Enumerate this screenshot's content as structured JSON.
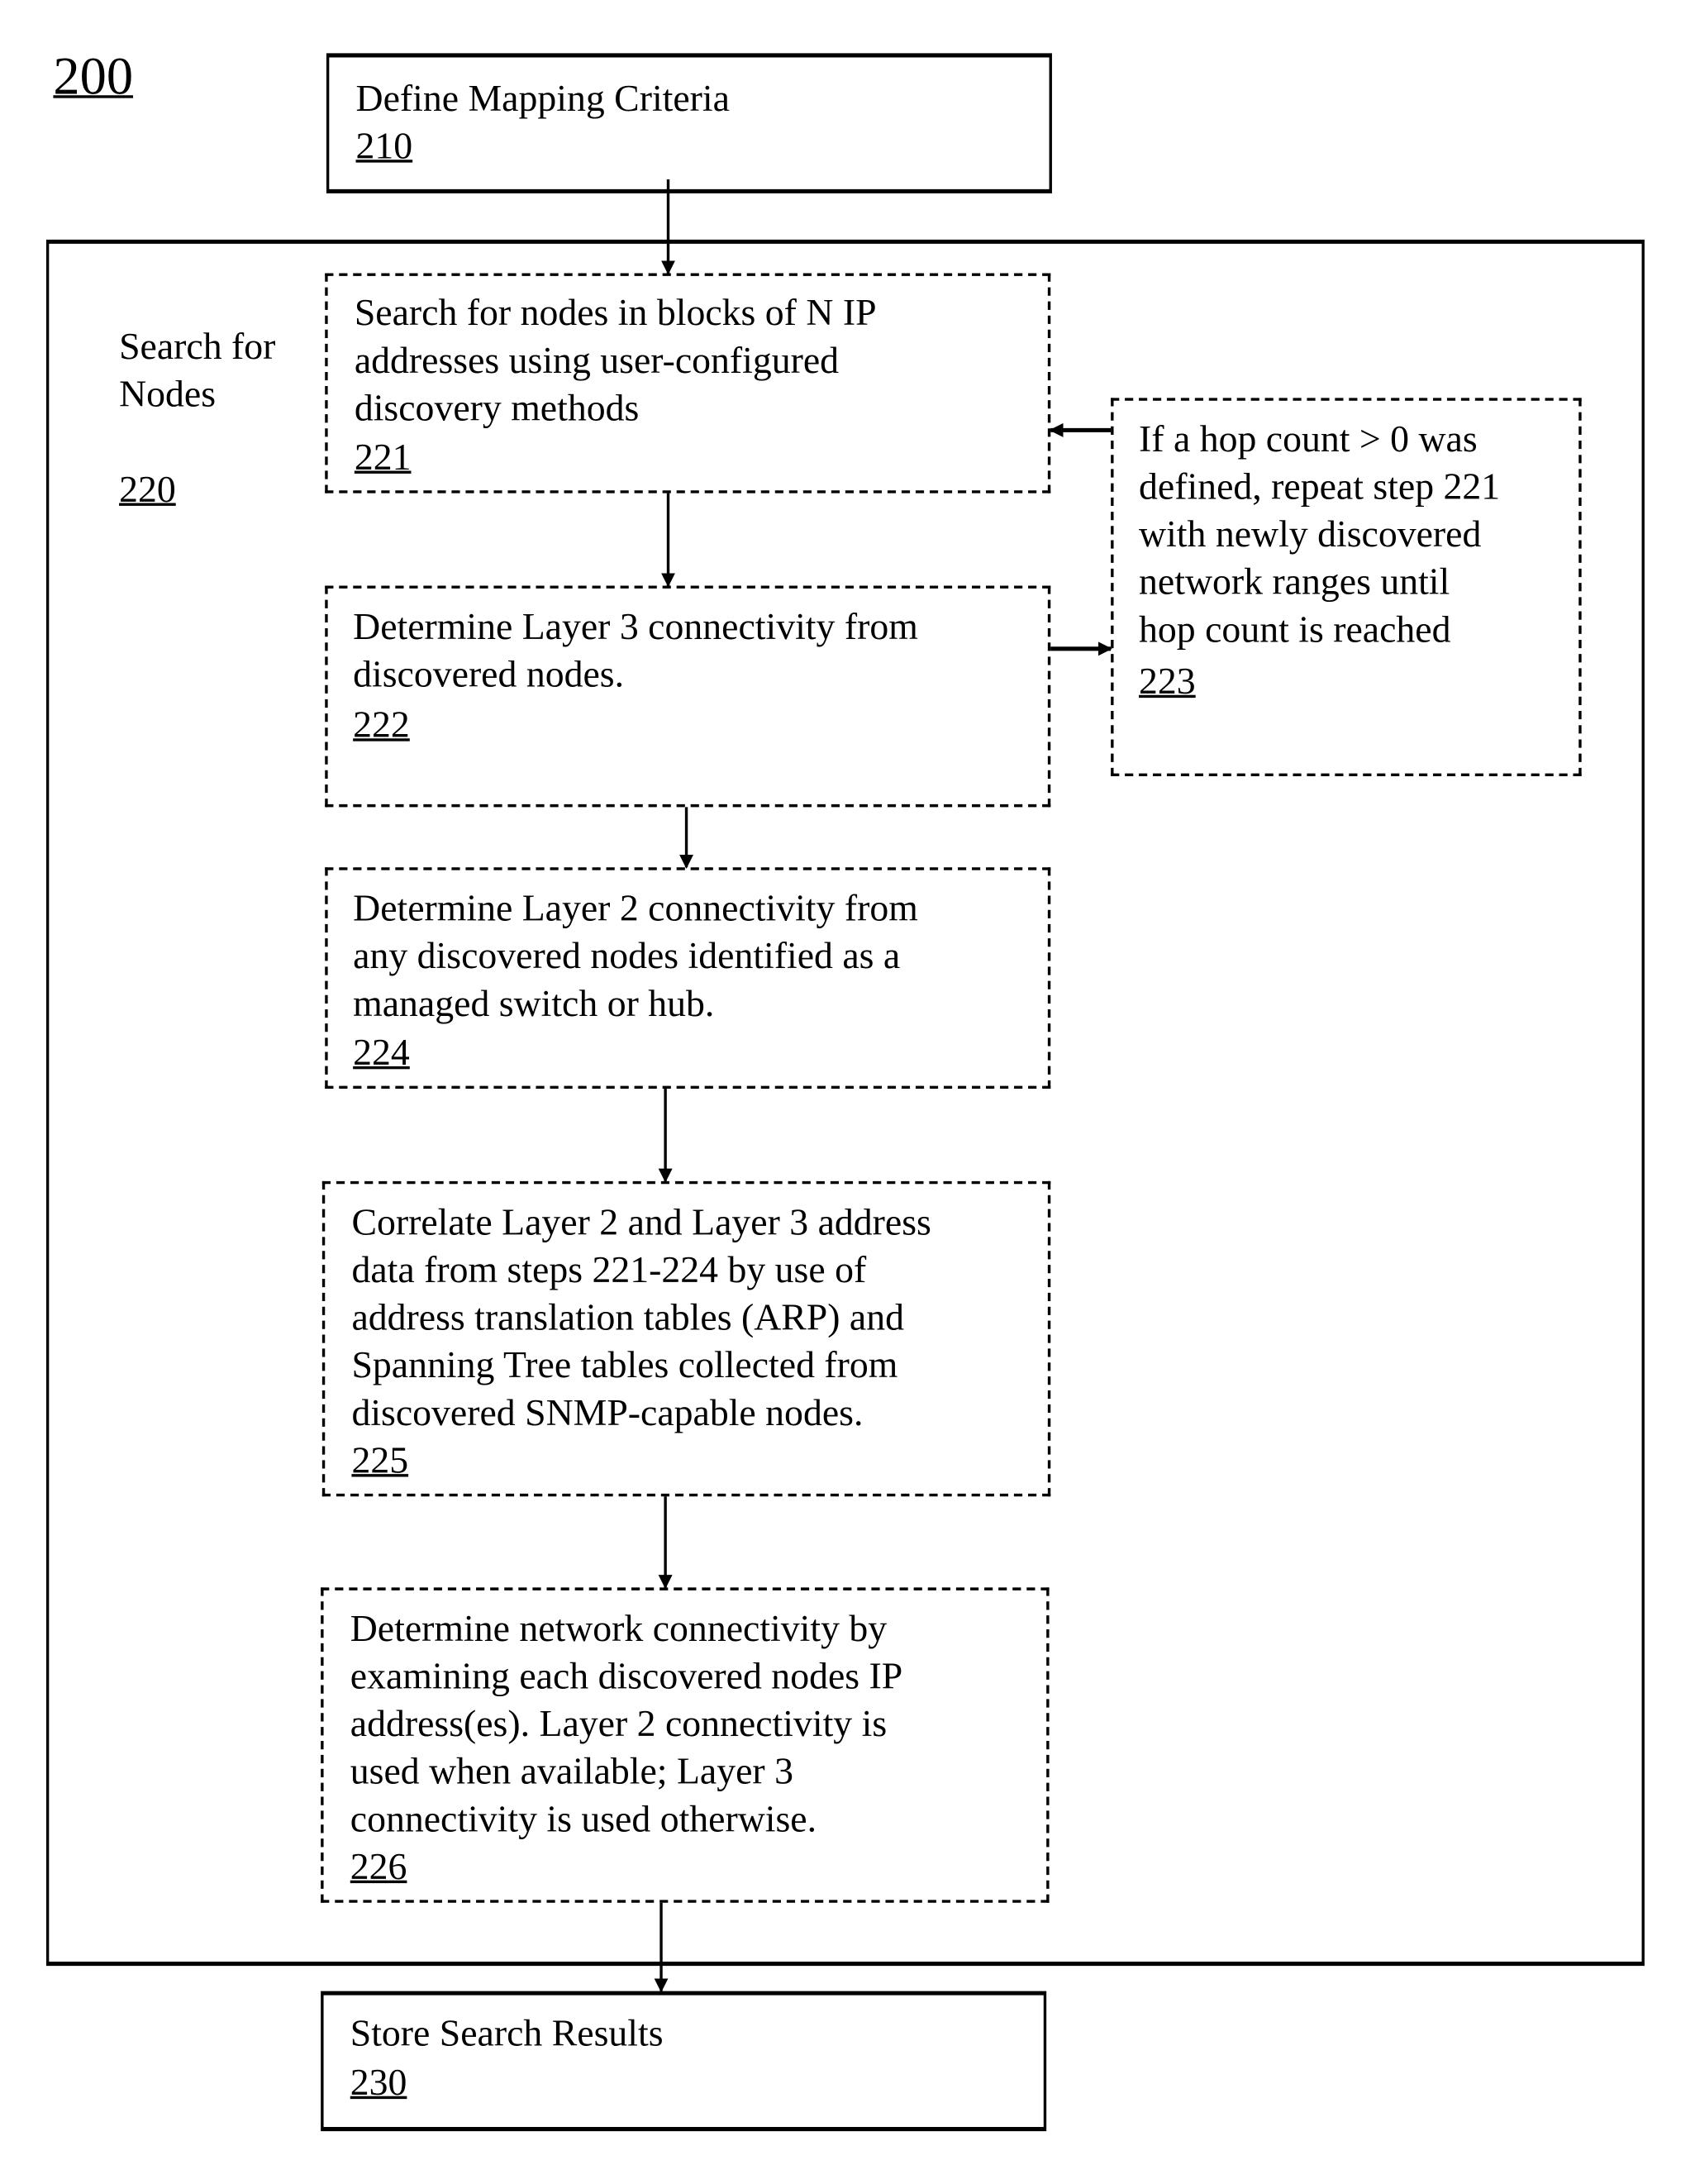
{
  "figure": {
    "label": "200"
  },
  "steps": {
    "s210": {
      "text": "Define Mapping Criteria",
      "num": "210"
    },
    "s220": {
      "text": "Search for\nNodes",
      "num": "220"
    },
    "s221": {
      "text": "Search for nodes in blocks of N IP\naddresses using user-configured\ndiscovery methods",
      "num": "221"
    },
    "s222": {
      "text": "Determine Layer 3 connectivity from\ndiscovered nodes.",
      "num": "222"
    },
    "s223": {
      "text": "If a hop count > 0 was\ndefined, repeat step 221\nwith newly discovered\nnetwork ranges until\nhop count is reached",
      "num": "223"
    },
    "s224": {
      "text": "Determine Layer 2 connectivity from\nany discovered nodes identified as a\nmanaged switch or hub.",
      "num": "224"
    },
    "s225": {
      "text": "Correlate Layer 2 and Layer 3 address\ndata from steps 221-224 by use of\naddress translation tables (ARP) and\nSpanning Tree tables collected from\ndiscovered SNMP-capable nodes.",
      "num": "225"
    },
    "s226": {
      "text": "Determine network connectivity by\nexamining each discovered nodes IP\naddress(es). Layer 2 connectivity is\nused when available; Layer 3\nconnectivity is used otherwise.",
      "num": "226"
    },
    "s230": {
      "text": "Store Search Results",
      "num": "230"
    }
  },
  "connections": [
    {
      "from": "210",
      "to": "221"
    },
    {
      "from": "221",
      "to": "222"
    },
    {
      "from": "222",
      "to": "223"
    },
    {
      "from": "223",
      "to": "221"
    },
    {
      "from": "222",
      "to": "224"
    },
    {
      "from": "224",
      "to": "225"
    },
    {
      "from": "225",
      "to": "226"
    },
    {
      "from": "226",
      "to": "230"
    }
  ]
}
